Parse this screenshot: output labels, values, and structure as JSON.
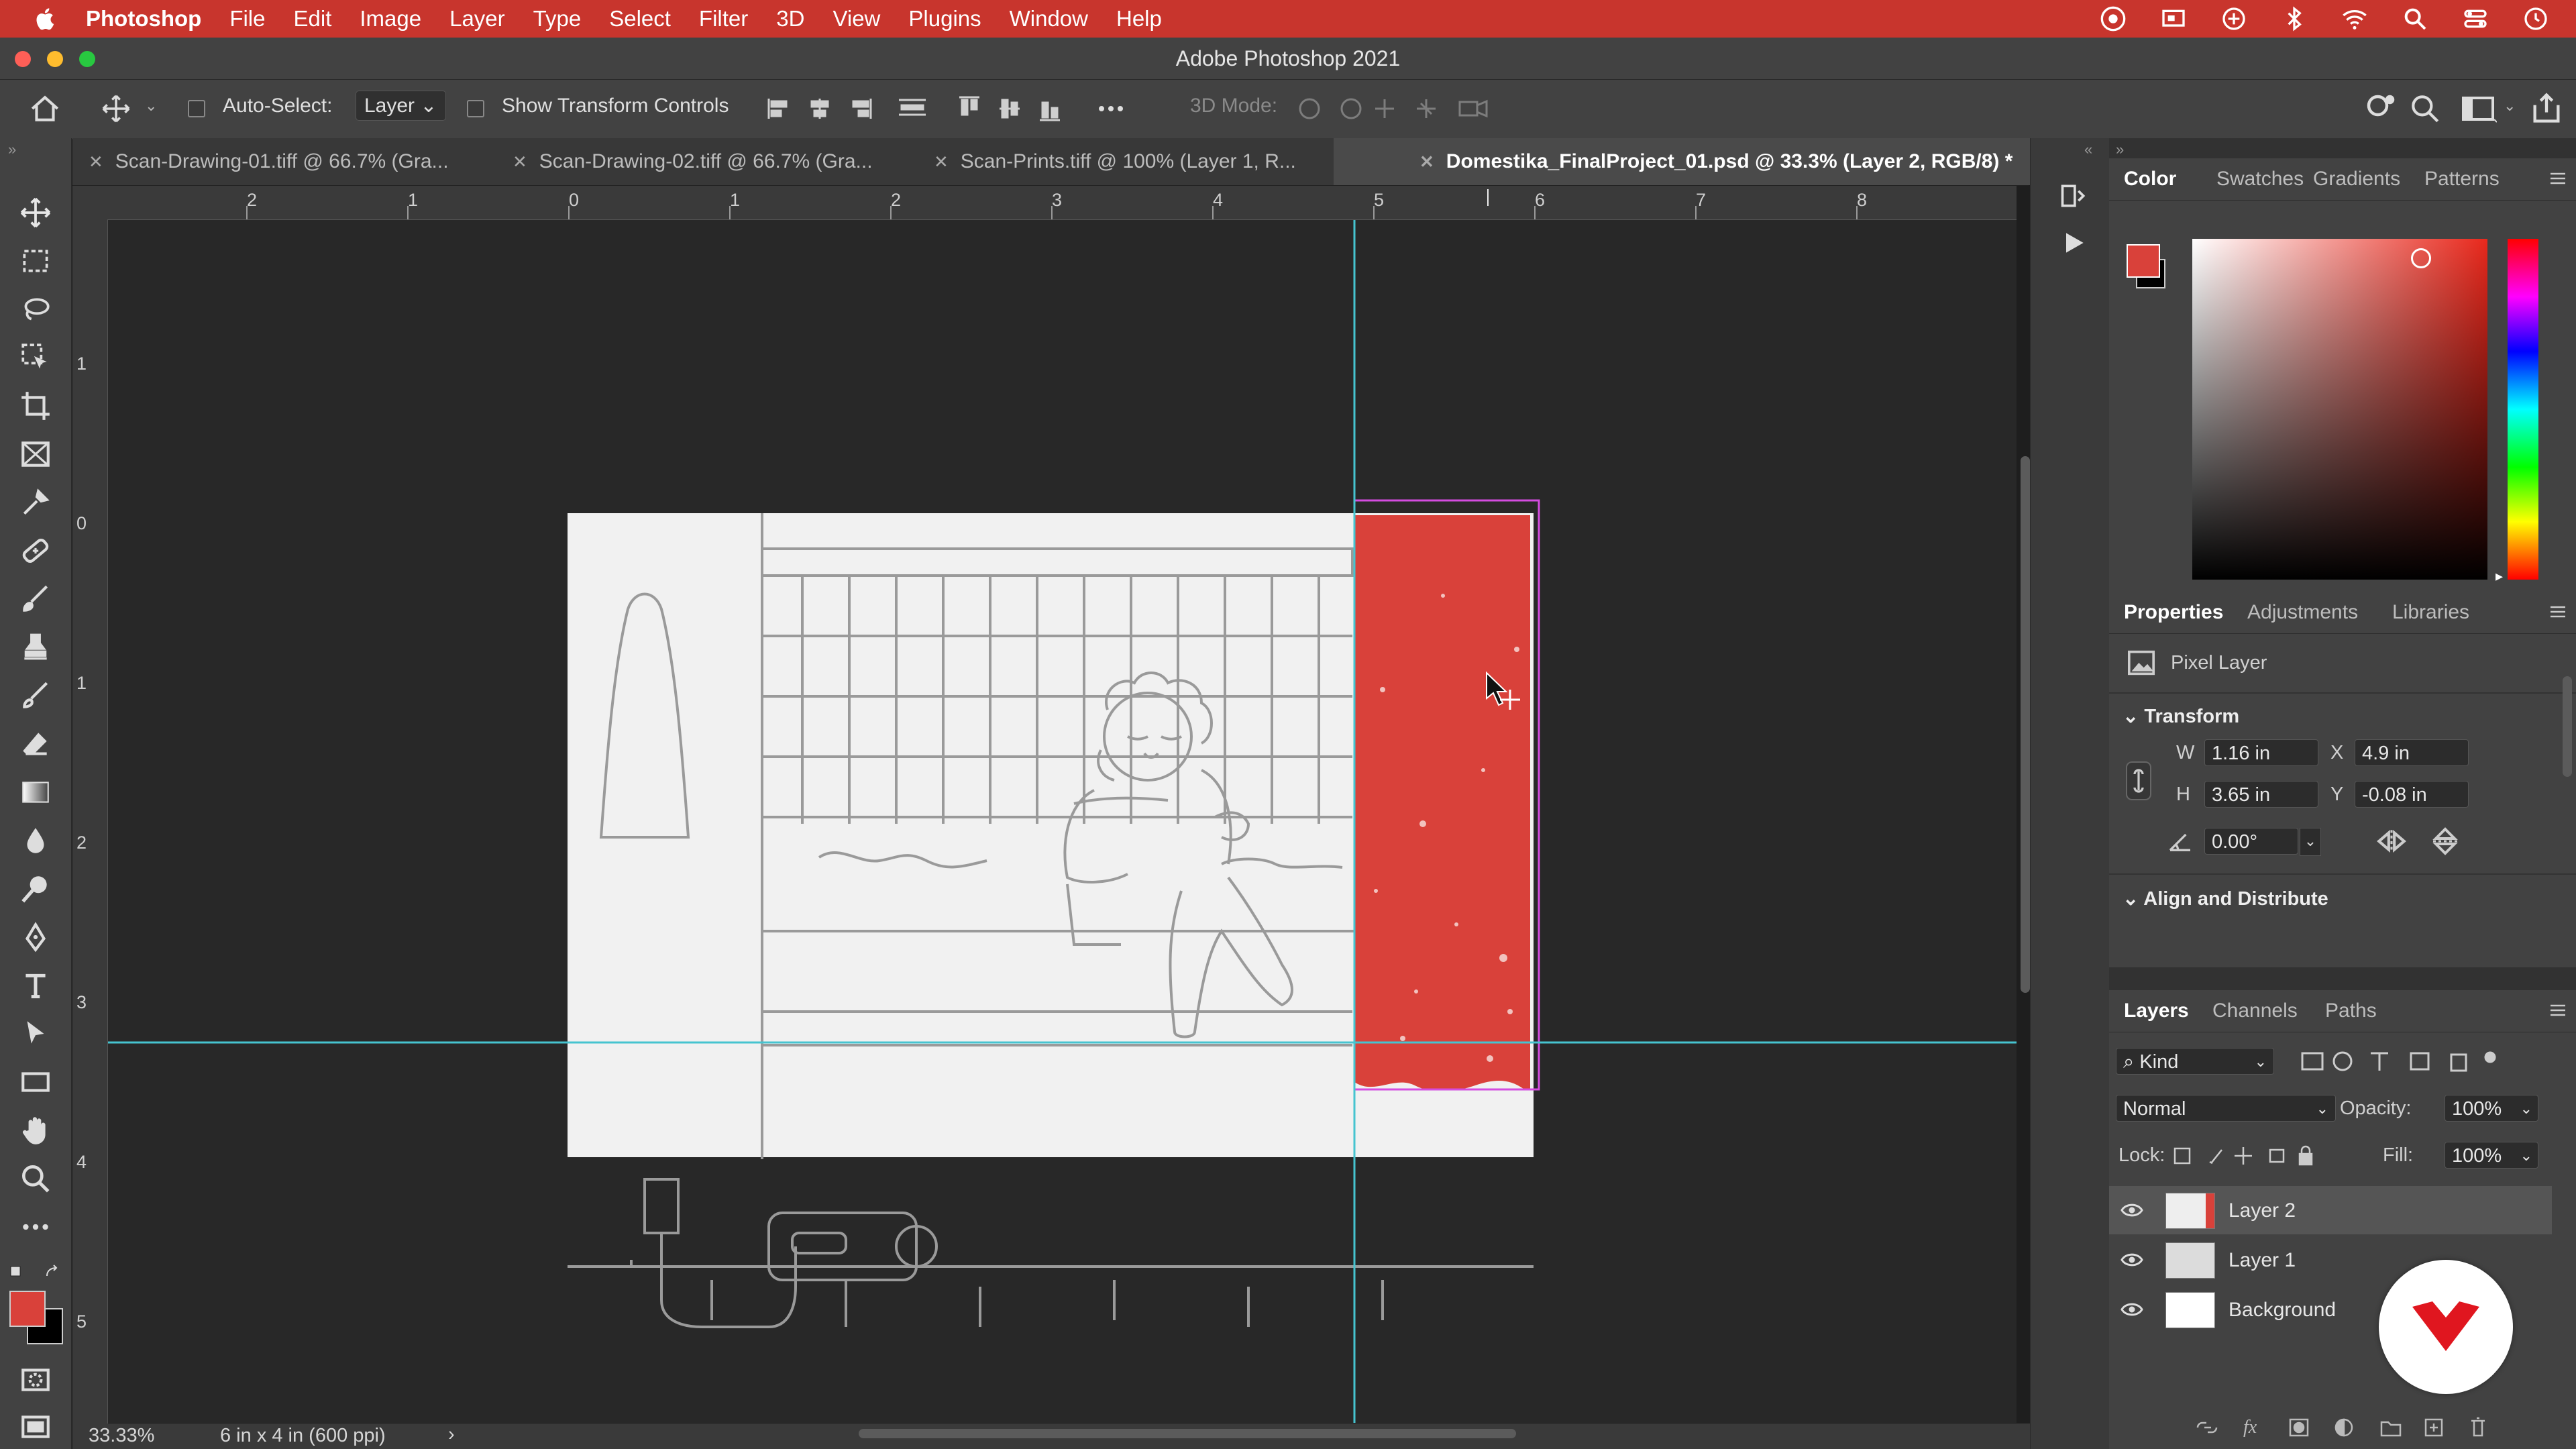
{
  "menubar": {
    "app": "Photoshop",
    "items": [
      "File",
      "Edit",
      "Image",
      "Layer",
      "Type",
      "Select",
      "Filter",
      "3D",
      "View",
      "Plugins",
      "Window",
      "Help"
    ]
  },
  "window": {
    "title": "Adobe Photoshop 2021"
  },
  "options": {
    "auto_select_label": "Auto-Select:",
    "auto_select_value": "Layer",
    "transform_controls_label": "Show Transform Controls",
    "mode_3d_label": "3D Mode:"
  },
  "tabs": [
    {
      "label": "Scan-Drawing-01.tiff @ 66.7% (Gra...",
      "active": false
    },
    {
      "label": "Scan-Drawing-02.tiff @ 66.7% (Gra...",
      "active": false
    },
    {
      "label": "Scan-Prints.tiff @ 100% (Layer 1, R...",
      "active": false
    },
    {
      "label": "Domestika_FinalProject_01.psd @ 33.3% (Layer 2, RGB/8) *",
      "active": true
    }
  ],
  "rulers": {
    "horizontal": [
      "2",
      "1",
      "0",
      "1",
      "2",
      "3",
      "4",
      "5",
      "6",
      "7",
      "8"
    ],
    "vertical": [
      "1",
      "0",
      "1",
      "2",
      "3",
      "4",
      "5"
    ]
  },
  "status": {
    "zoom": "33.33%",
    "doc_size": "6 in x 4 in (600 ppi)"
  },
  "color_panel": {
    "tabs": [
      "Color",
      "Swatches",
      "Gradients",
      "Patterns"
    ],
    "foreground": "#d9413a",
    "background": "#000000"
  },
  "properties": {
    "tabs": [
      "Properties",
      "Adjustments",
      "Libraries"
    ],
    "kind": "Pixel Layer",
    "transform_heading": "Transform",
    "w_label": "W",
    "w": "1.16 in",
    "h_label": "H",
    "h": "3.65 in",
    "x_label": "X",
    "x": "4.9 in",
    "y_label": "Y",
    "y": "-0.08 in",
    "angle": "0.00°",
    "align_heading": "Align and Distribute"
  },
  "layers_panel": {
    "tabs": [
      "Layers",
      "Channels",
      "Paths"
    ],
    "filter": "Kind",
    "blend_mode": "Normal",
    "opacity_label": "Opacity:",
    "opacity": "100%",
    "lock_label": "Lock:",
    "fill_label": "Fill:",
    "fill": "100%",
    "layers": [
      {
        "name": "Layer 2",
        "selected": true
      },
      {
        "name": "Layer 1",
        "selected": false
      },
      {
        "name": "Background",
        "selected": false
      }
    ]
  },
  "accent": "#c8352d"
}
